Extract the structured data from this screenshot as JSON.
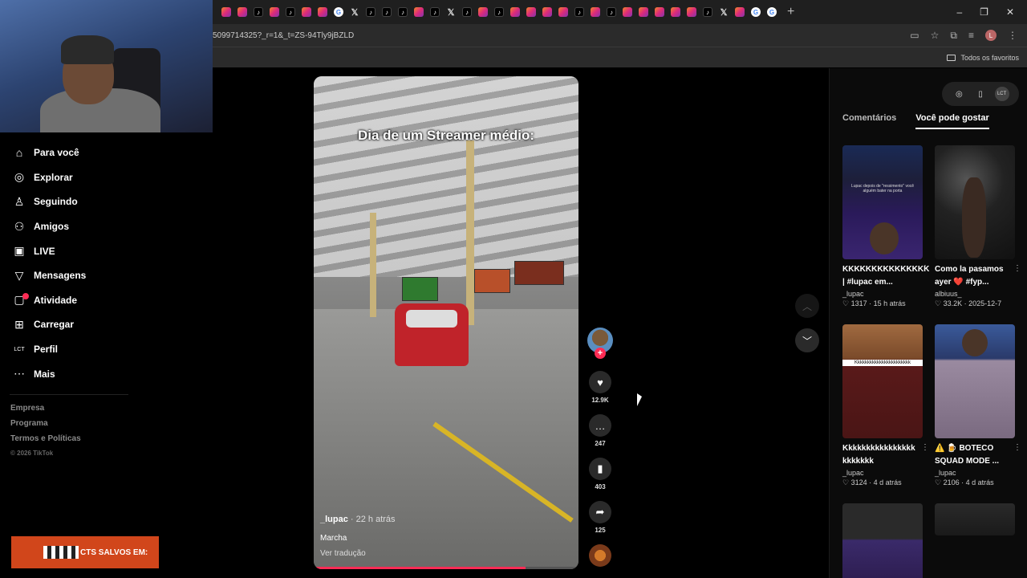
{
  "browser": {
    "tabs": [
      "instagram",
      "instagram",
      "tiktok",
      "instagram",
      "tiktok",
      "instagram",
      "instagram",
      "google",
      "x",
      "tiktok",
      "tiktok",
      "tiktok",
      "instagram",
      "tiktok",
      "x",
      "tiktok",
      "instagram",
      "tiktok",
      "instagram",
      "instagram",
      "instagram",
      "instagram",
      "tiktok",
      "instagram",
      "tiktok",
      "instagram",
      "instagram",
      "instagram",
      "instagram",
      "instagram",
      "tiktok",
      "x",
      "instagram",
      "google",
      "google"
    ],
    "new_tab": "+",
    "url": "5099714325?_r=1&_t=ZS-94Tly9jBZLD",
    "bookmarks_label": "Todos os favoritos",
    "profile_initial": "L"
  },
  "sidebar": {
    "items": [
      {
        "label": "Para você",
        "icon": "home-icon"
      },
      {
        "label": "Explorar",
        "icon": "compass-icon"
      },
      {
        "label": "Seguindo",
        "icon": "following-icon"
      },
      {
        "label": "Amigos",
        "icon": "friends-icon"
      },
      {
        "label": "LIVE",
        "icon": "live-icon"
      },
      {
        "label": "Mensagens",
        "icon": "messages-icon"
      },
      {
        "label": "Atividade",
        "icon": "activity-icon"
      },
      {
        "label": "Carregar",
        "icon": "upload-icon"
      },
      {
        "label": "Perfil",
        "icon": "profile-icon"
      },
      {
        "label": "Mais",
        "icon": "more-icon"
      }
    ],
    "footer": [
      "Empresa",
      "Programa",
      "Termos e Políticas"
    ],
    "copyright": "© 2026 TikTok"
  },
  "promo": {
    "text": "CTS SALVOS EM:"
  },
  "video": {
    "overlay_title": "Dia de um Streamer médio:",
    "author": "_lupac",
    "time": " · 22 h atrás",
    "sound": "Marcha",
    "translate": "Ver tradução",
    "progress": 0.8
  },
  "actions": {
    "likes": "12.9K",
    "comments": "247",
    "saves": "403",
    "shares": "125"
  },
  "right_panel": {
    "tabs": [
      "Comentários",
      "Você pode gostar"
    ],
    "active_tab": 1,
    "cards": [
      {
        "title": "KKKKKKKKKKKKKKK | #lupac em...",
        "author": "_lupac",
        "likes": "1317",
        "time": "15 h atrás"
      },
      {
        "title": "Como la pasamos ayer ❤️ #fyp...",
        "author": "albiuus_",
        "likes": "33.2K",
        "time": "2025-12-7"
      },
      {
        "title": "Kkkkkkkkkkkkkkkkkkkkkkk",
        "author": "_lupac",
        "likes": "3124",
        "time": "4 d atrás"
      },
      {
        "title": "⚠️ 🍺 BOTECO SQUAD MODE ...",
        "author": "_lupac",
        "likes": "2106",
        "time": "4 d atrás"
      }
    ],
    "thumb_caption_1": "Lupac depois de \"ressimento\" você alguém bater na porta",
    "thumb_caption_3": "Kkkkkkkkkkkkkkkkkkkkkkk"
  },
  "colors": {
    "accent": "#fe2c55",
    "background": "#000000",
    "panel": "#0b0b0b"
  }
}
